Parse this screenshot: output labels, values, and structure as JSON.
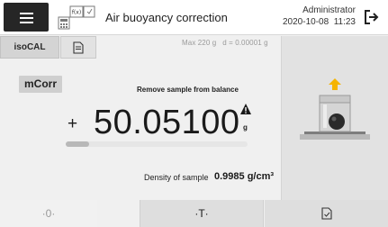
{
  "header": {
    "title": "Air buoyancy correction",
    "app_icon_text": "f(x)",
    "user": "Administrator",
    "datetime": "2020-10-08  11:23"
  },
  "tabs": {
    "isocal_label": "isoCAL",
    "mcorr_label": "mCorr"
  },
  "main": {
    "limits_text": "Max 220 g   d = 0.00001 g",
    "instruction": "Remove sample from balance",
    "sign": "+",
    "weight": "50.05100",
    "unit": "g",
    "progress": 0.13,
    "density_label": "Density of sample",
    "density_value": "0.9985 g/cm³"
  },
  "toolbar": {
    "zero_label": "·0·",
    "tare_label": "·T·"
  },
  "colors": {
    "arrow": "#f5b400",
    "menu_bg": "#262626"
  },
  "icons": {
    "menu": "hamburger-icon",
    "logout": "logout-icon",
    "doc": "document-icon",
    "warning": "warning-icon",
    "print": "print-document-icon"
  }
}
